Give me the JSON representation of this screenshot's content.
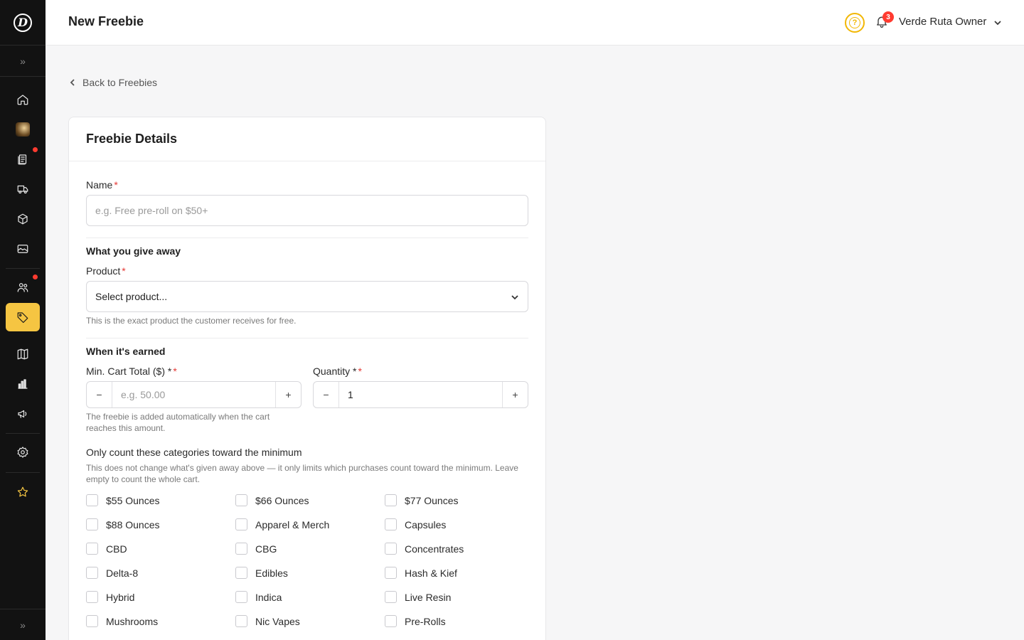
{
  "header": {
    "title": "New Freebie",
    "notification_count": "3",
    "user_name": "Verde Ruta Owner",
    "help_glyph": "?"
  },
  "sidebar": {
    "items": [
      {
        "name": "home-icon"
      },
      {
        "name": "store-avatar"
      },
      {
        "name": "orders-icon",
        "dot": true
      },
      {
        "name": "delivery-icon"
      },
      {
        "name": "products-icon"
      },
      {
        "name": "media-icon"
      },
      {
        "name": "customers-icon",
        "dot": true
      },
      {
        "name": "promotions-icon",
        "active": true
      },
      {
        "name": "catalog-icon"
      },
      {
        "name": "analytics-icon"
      },
      {
        "name": "marketing-icon"
      },
      {
        "name": "settings-icon"
      },
      {
        "name": "star-icon"
      }
    ],
    "accent": "#f5c542"
  },
  "back_link": "Back to Freebies",
  "card": {
    "title": "Freebie Details",
    "name_label": "Name",
    "name_placeholder": "e.g. Free pre-roll on $50+",
    "giveaway_title": "What you give away",
    "product_label": "Product",
    "product_value": "Select product...",
    "product_hint": "This is the exact product the customer receives for free.",
    "earned_title": "When it's earned",
    "min_cart_label": "Min. Cart Total ($) *",
    "min_cart_placeholder": "e.g. 50.00",
    "min_cart_hint": "The freebie is added automatically when the cart reaches this amount.",
    "quantity_label": "Quantity *",
    "quantity_value": "1",
    "required_mark": "*",
    "minus": "−",
    "plus": "+",
    "categories_title": "Only count these categories toward the minimum",
    "categories_hint": "This does not change what's given away above — it only limits which purchases count toward the minimum. Leave empty to count the whole cart.",
    "categories": [
      "$55 Ounces",
      "$66 Ounces",
      "$77 Ounces",
      "$88 Ounces",
      "Apparel & Merch",
      "Capsules",
      "CBD",
      "CBG",
      "Concentrates",
      "Delta-8",
      "Edibles",
      "Hash & Kief",
      "Hybrid",
      "Indica",
      "Live Resin",
      "Mushrooms",
      "Nic Vapes",
      "Pre-Rolls"
    ]
  }
}
